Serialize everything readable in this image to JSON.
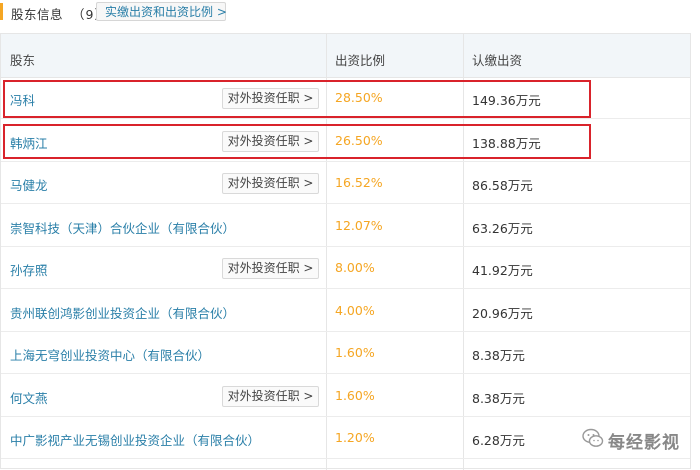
{
  "header": {
    "title": "股东信息",
    "count": "（9）",
    "ratio_button": "实缴出资和出资比例 >"
  },
  "table": {
    "columns": [
      "股东",
      "出资比例",
      "认缴出资"
    ],
    "rows": [
      {
        "name": "冯科",
        "button": "对外投资任职 >",
        "ratio": "28.50%",
        "amount": "149.36万元"
      },
      {
        "name": "韩炳江",
        "button": "对外投资任职 >",
        "ratio": "26.50%",
        "amount": "138.88万元"
      },
      {
        "name": "马健龙",
        "button": "对外投资任职 >",
        "ratio": "16.52%",
        "amount": "86.58万元"
      },
      {
        "name": "崇智科技（天津）合伙企业（有限合伙）",
        "button": "",
        "ratio": "12.07%",
        "amount": "63.26万元"
      },
      {
        "name": "孙存照",
        "button": "对外投资任职 >",
        "ratio": "8.00%",
        "amount": "41.92万元"
      },
      {
        "name": "贵州联创鸿影创业投资企业（有限合伙）",
        "button": "",
        "ratio": "4.00%",
        "amount": "20.96万元"
      },
      {
        "name": "上海无穹创业投资中心（有限合伙）",
        "button": "",
        "ratio": "1.60%",
        "amount": "8.38万元"
      },
      {
        "name": "何文燕",
        "button": "对外投资任职 >",
        "ratio": "1.60%",
        "amount": "8.38万元"
      },
      {
        "name": "中广影视产业无锡创业投资企业（有限合伙）",
        "button": "",
        "ratio": "1.20%",
        "amount": "6.28万元"
      }
    ]
  },
  "watermark": {
    "text": "每经影视"
  },
  "colors": {
    "accent": "#f5a623",
    "link": "#2a7fa8",
    "highlight": "#d9232b"
  }
}
